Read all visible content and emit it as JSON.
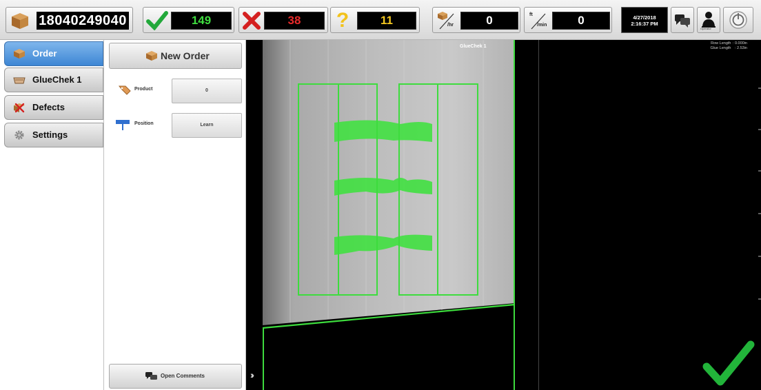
{
  "toolbar": {
    "order_number": "18040249040",
    "good_count": "149",
    "bad_count": "38",
    "unknown_count": "11",
    "speed_per_hour": "0",
    "speed_per_hour_unit": "/hr",
    "speed_per_min": "0",
    "speed_per_min_unit_top": "ft",
    "speed_per_min_unit_bottom": "/min",
    "date": "4/27/2018",
    "time": "2:16:37 PM",
    "user_label": "Operator"
  },
  "nav": {
    "items": [
      {
        "label": "Order",
        "icon": "box-icon",
        "active": true
      },
      {
        "label": "GlueChek 1",
        "icon": "camera-icon",
        "active": false
      },
      {
        "label": "Defects",
        "icon": "defects-icon",
        "active": false
      },
      {
        "label": "Settings",
        "icon": "gear-icon",
        "active": false
      }
    ]
  },
  "panel": {
    "new_order_label": "New Order",
    "product_label": "Product",
    "product_value": "0",
    "position_label": "Position",
    "position_value": "Learn",
    "open_comments_label": "Open Comments"
  },
  "viewer": {
    "camera_label": "GlueChek 1",
    "row_length_label": "Row Length",
    "row_length_value": ": 0.000in",
    "glue_length_label": "Glue Length",
    "glue_length_value": ": 2.53in"
  },
  "colors": {
    "accent_blue": "#3d86d4",
    "good_green": "#22a83a",
    "bad_red": "#d42020",
    "unknown_yellow": "#f2c21b",
    "inspection_green": "#3ddc3d"
  }
}
